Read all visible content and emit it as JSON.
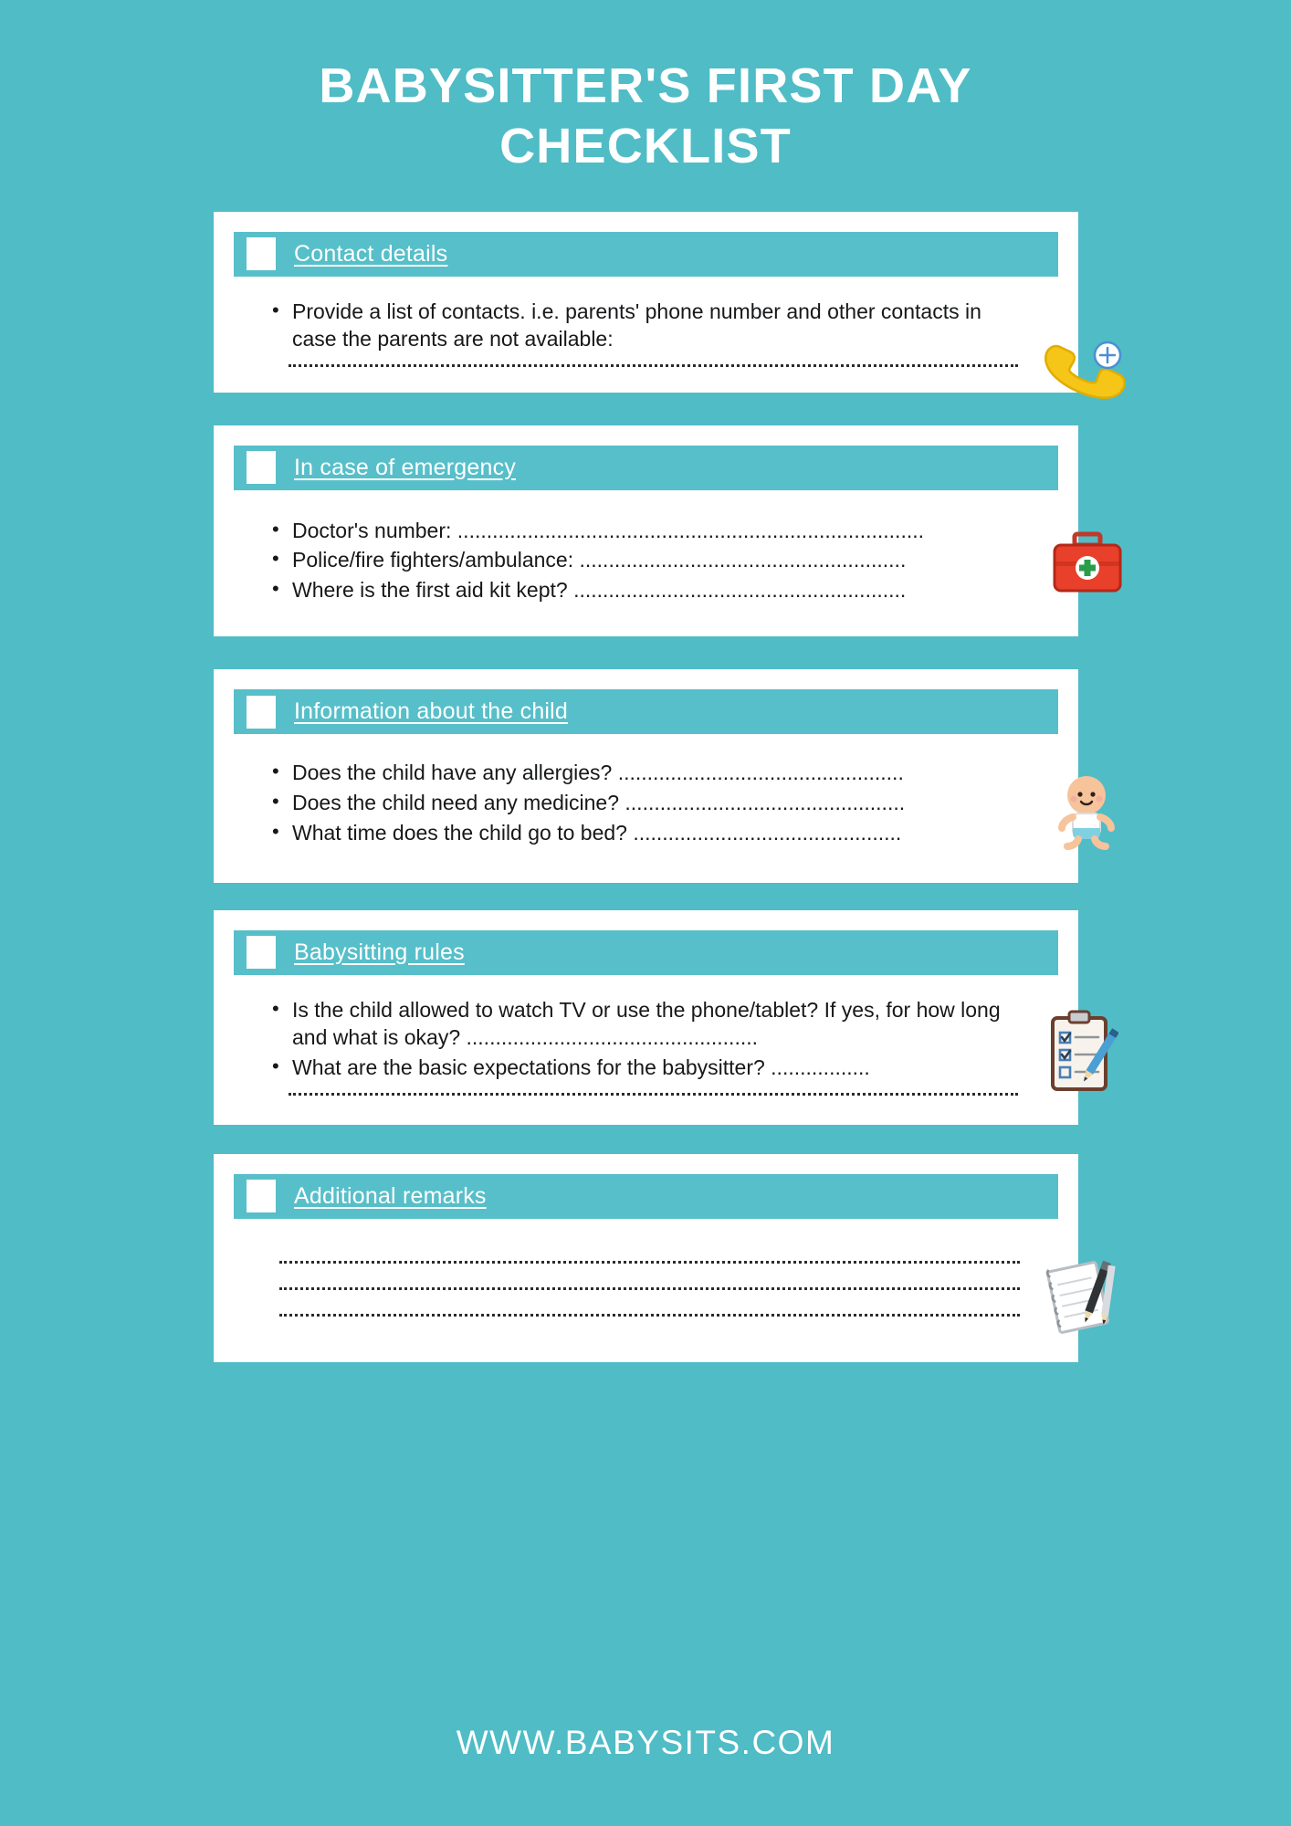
{
  "document": {
    "title_lines": [
      "BABYSITTER'S FIRST DAY",
      "CHECKLIST"
    ],
    "accent_color": "#4fbcc6",
    "header_bar_color": "#57bfc9",
    "card_color": "#ffffff",
    "text_color": "#17181a"
  },
  "sections": [
    {
      "id": "contact-details",
      "title": "Contact details",
      "icon": "telephone-add-icon",
      "bullets": [
        "Provide a list of contacts. i.e. parents' phone number and other contacts in case the parents are not available:"
      ],
      "fill_lines": 1
    },
    {
      "id": "in-case-of-emergency",
      "title": "In case of emergency",
      "icon": "first-aid-kit-icon",
      "bullets": [
        "Doctor's number: ................................................................................",
        "Police/fire fighters/ambulance: ........................................................",
        "Where is the first aid kit kept? ........................................................."
      ],
      "fill_lines": 0
    },
    {
      "id": "information-about-the-child",
      "title": "Information about the child",
      "icon": "baby-icon",
      "bullets": [
        "Does the child have any allergies? .................................................",
        "Does the child need any medicine? ................................................",
        "What time does the child go to bed? .............................................."
      ],
      "fill_lines": 0
    },
    {
      "id": "babysitting-rules",
      "title": "Babysitting rules",
      "icon": "clipboard-checklist-icon",
      "bullets": [
        "Is the child allowed to watch TV or use the phone/tablet? If yes, for how long and what is okay? ..................................................",
        "What are the basic expectations for the babysitter? ................."
      ],
      "fill_lines": 1
    },
    {
      "id": "additional-remarks",
      "title": "Additional remarks",
      "icon": "notebook-pen-icon",
      "bullets": [],
      "fill_lines": 3
    }
  ],
  "footer": {
    "url": "WWW.BABYSITS.COM"
  }
}
